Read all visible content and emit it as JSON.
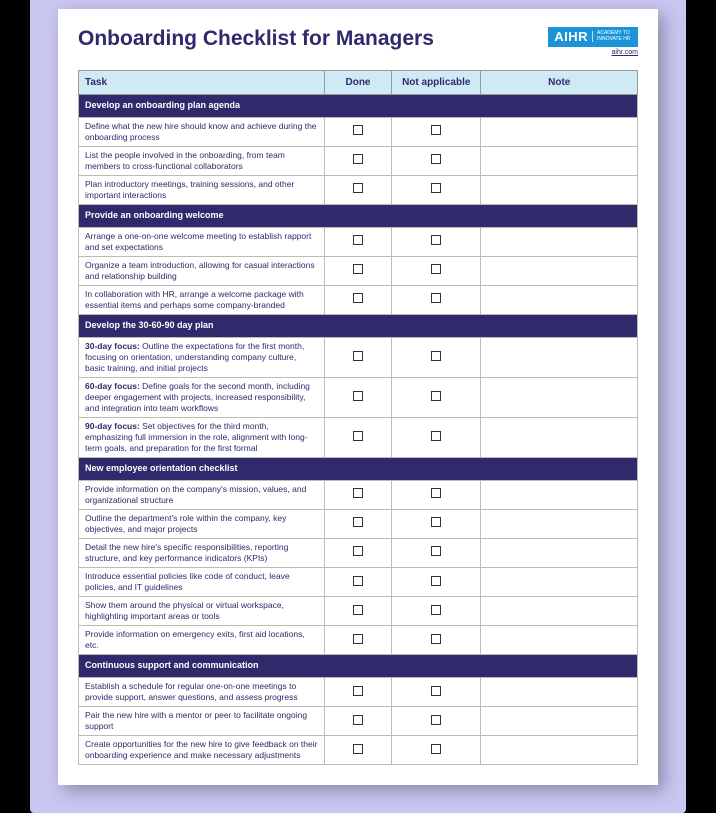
{
  "title": "Onboarding Checklist for Managers",
  "brand": {
    "short": "AIHR",
    "sub": "ACADEMY TO INNOVATE HR",
    "link": "aihr.com"
  },
  "columns": {
    "task": "Task",
    "done": "Done",
    "na": "Not applicable",
    "note": "Note"
  },
  "sections": [
    {
      "heading": "Develop an onboarding plan agenda",
      "rows": [
        {
          "lead": "",
          "text": "Define what the new hire should know and achieve during the onboarding process"
        },
        {
          "lead": "",
          "text": "List the people involved in the onboarding, from team members to cross-functional collaborators"
        },
        {
          "lead": "",
          "text": "Plan introductory meetings, training sessions, and other important interactions"
        }
      ]
    },
    {
      "heading": "Provide an onboarding welcome",
      "rows": [
        {
          "lead": "",
          "text": "Arrange a one-on-one welcome meeting to establish rapport and set expectations"
        },
        {
          "lead": "",
          "text": "Organize a team introduction, allowing for casual interactions and relationship building"
        },
        {
          "lead": "",
          "text": "In collaboration with HR, arrange a welcome package with essential items and perhaps some company-branded"
        }
      ]
    },
    {
      "heading": "Develop the 30-60-90 day plan",
      "rows": [
        {
          "lead": "30-day focus:",
          "text": " Outline the expectations for the first month, focusing on orientation, understanding company culture, basic training, and initial projects"
        },
        {
          "lead": "60-day focus:",
          "text": " Define goals for the second month, including deeper engagement with projects, increased responsibility, and integration into team workflows"
        },
        {
          "lead": "90-day focus:",
          "text": " Set objectives for the third month, emphasizing full immersion in the role, alignment with long-term goals, and preparation for the first formal"
        }
      ]
    },
    {
      "heading": "New employee orientation checklist",
      "rows": [
        {
          "lead": "",
          "text": "Provide information on the company's mission, values, and organizational structure"
        },
        {
          "lead": "",
          "text": "Outline the department's role within the company, key objectives, and major projects"
        },
        {
          "lead": "",
          "text": "Detail the new hire's specific responsibilities, reporting structure, and key performance indicators (KPIs)"
        },
        {
          "lead": "",
          "text": "Introduce essential policies like code of conduct, leave policies, and IT guidelines"
        },
        {
          "lead": "",
          "text": "Show them around the physical or virtual workspace, highlighting important areas or tools"
        },
        {
          "lead": "",
          "text": "Provide information on emergency exits, first aid locations, etc."
        }
      ]
    },
    {
      "heading": "Continuous support and communication",
      "rows": [
        {
          "lead": "",
          "text": "Establish a schedule for regular one-on-one meetings to provide support, answer questions, and assess progress"
        },
        {
          "lead": "",
          "text": "Pair the new hire with a mentor or peer to facilitate ongoing support"
        },
        {
          "lead": "",
          "text": "Create opportunities for the new hire to give feedback on their onboarding experience and make necessary adjustments"
        }
      ]
    }
  ]
}
